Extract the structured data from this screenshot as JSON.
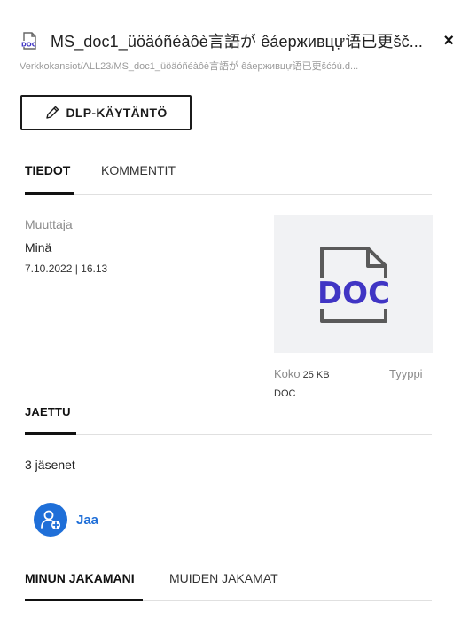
{
  "header": {
    "title": "MS_doc1_üöäóñéàôè言語が êáерживцự语已更šč...",
    "path": "Verkkokansiot/ALL23/MS_doc1_üöäóñéàôè言語が êáерживцự语已更šćóú.d...",
    "doc_icon": "doc-file-icon",
    "close_label": "×"
  },
  "dlp_button": {
    "label": "DLP-KÄYTÄNTÖ",
    "icon": "pencil-icon"
  },
  "tabs": [
    {
      "label": "TIEDOT",
      "active": true
    },
    {
      "label": "KOMMENTIT",
      "active": false
    }
  ],
  "info": {
    "modifier_label": "Muuttaja",
    "modifier_value": "Minä",
    "modified_date": "7.10.2022 | 16.13"
  },
  "thumbnail": {
    "text": "DOC",
    "icon": "doc-file-icon",
    "accent": "#4035c4"
  },
  "meta": {
    "size_label": "Koko",
    "size_value": "25 KB",
    "type_label": "Tyyppi",
    "type_value": "DOC"
  },
  "shared": {
    "title": "JAETTU",
    "members": "3 jäsenet",
    "share_label": "Jaa",
    "share_icon": "add-user-icon",
    "accent": "#1f6fd8"
  },
  "share_tabs": [
    {
      "label": "MINUN JAKAMANI",
      "active": true
    },
    {
      "label": "MUIDEN JAKAMAT",
      "active": false
    }
  ]
}
